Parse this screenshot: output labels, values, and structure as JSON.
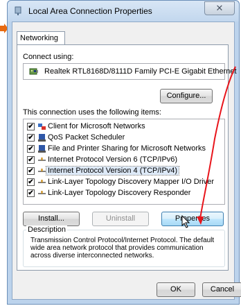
{
  "window": {
    "title": "Local Area Connection Properties",
    "close_glyph": "✕"
  },
  "tabs": [
    {
      "label": "Networking"
    }
  ],
  "networking": {
    "connect_using_label": "Connect using:",
    "adapter_name": "Realtek RTL8168D/8111D Family PCI-E Gigabit Ethernet",
    "configure_label": "Configure...",
    "items_label": "This connection uses the following items:",
    "items": [
      {
        "label": "Client for Microsoft Networks",
        "checked": true,
        "icon": "network-client-icon"
      },
      {
        "label": "QoS Packet Scheduler",
        "checked": true,
        "icon": "service-icon"
      },
      {
        "label": "File and Printer Sharing for Microsoft Networks",
        "checked": true,
        "icon": "service-icon"
      },
      {
        "label": "Internet Protocol Version 6 (TCP/IPv6)",
        "checked": true,
        "icon": "protocol-icon"
      },
      {
        "label": "Internet Protocol Version 4 (TCP/IPv4)",
        "checked": true,
        "icon": "protocol-icon",
        "selected": true
      },
      {
        "label": "Link-Layer Topology Discovery Mapper I/O Driver",
        "checked": true,
        "icon": "protocol-icon"
      },
      {
        "label": "Link-Layer Topology Discovery Responder",
        "checked": true,
        "icon": "protocol-icon"
      }
    ],
    "install_label": "Install...",
    "uninstall_label": "Uninstall",
    "properties_label": "Properties",
    "description_legend": "Description",
    "description_lines": [
      "Transmission Control Protocol/Internet Protocol. The default",
      "wide area network protocol that provides communication",
      "across diverse interconnected networks."
    ]
  },
  "footer": {
    "ok_label": "OK",
    "cancel_label": "Cancel"
  },
  "colors": {
    "annotation_red": "#e8141b",
    "arrow_orange": "#e86a10"
  }
}
